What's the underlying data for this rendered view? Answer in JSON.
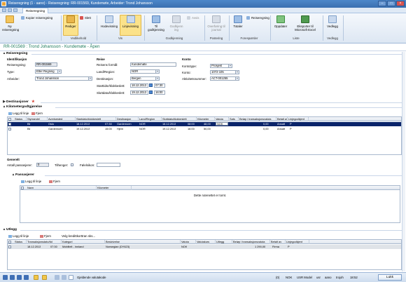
{
  "window": {
    "title": "Reiseregning (1 - aano) - Reiseregning: RR-001569, Kundemøte, Arbeider: Trond Johansson",
    "controls": {
      "minimize": "–",
      "maximize": "□",
      "close": "×"
    }
  },
  "ribbon_tab": "Reiseregning",
  "ribbon": {
    "new": {
      "label": "Ny reiseregning",
      "icon": "new-document-icon"
    },
    "copy": {
      "label": "Kopier reiseregning",
      "icon": "copy-icon"
    },
    "edit": {
      "label": "Rediger",
      "icon": "pencil-icon"
    },
    "delete": {
      "label": "Slett",
      "icon": "delete-icon"
    },
    "group_maintain": "Vedlikehold",
    "header_view": {
      "label": "Hodevisning",
      "icon": "header-view-icon"
    },
    "line_view": {
      "label": "Linjevisning",
      "icon": "line-view-icon"
    },
    "group_view": "Vis",
    "for_approval": {
      "label": "Til godkjenning",
      "icon": "submit-icon"
    },
    "approval": {
      "label": "Godkjenn ing",
      "icon": "approve-icon"
    },
    "reject": {
      "label": "Avvis",
      "icon": "reject-icon"
    },
    "group_approval": "Godkjenning",
    "post": {
      "label": "Overføring til journal",
      "icon": "post-icon"
    },
    "group_posting": "Postering",
    "totals": {
      "label": "Totaler",
      "icon": "totals-icon"
    },
    "accommodation": {
      "label": "Reiseregning",
      "icon": "travel-icon"
    },
    "group_enquiries": "Forespørsler",
    "refresh": {
      "label": "Oppdater",
      "icon": "refresh-icon"
    },
    "export": {
      "label": "Eksporter til Microsoft Excel",
      "icon": "excel-icon"
    },
    "group_list": "Liste",
    "attachments": {
      "label": "Vedlegg",
      "icon": "paperclip-icon"
    },
    "group_attachments": "Vedlegg"
  },
  "record_title": "RR-001569 : Trond Johansson - Kundemøte - Åpen",
  "sections": {
    "expense": "Reiseregning",
    "destinations": "Destinasjoner",
    "mileage": "Kilometergodtgjørelse",
    "general": "Generelt",
    "passengers": "Passasjerer",
    "expenses": "Utlegg"
  },
  "identification": {
    "heading": "Identifikasjon",
    "number_label": "Reiseregning:",
    "number": "RR-001569",
    "type_label": "Type:",
    "type": "Etter Regning",
    "worker_label": "Arbeider:",
    "worker": "Trond Johansson"
  },
  "trip": {
    "heading": "Reise",
    "purpose_label": "Reisens formål:",
    "purpose": "Kundemøte",
    "country_label": "Land/Region:",
    "country": "NOR",
    "destination_label": "Destinasjon:",
    "destination": "Bergen",
    "start_label": "Starttidsr/klokkeslett:",
    "start_date": "18.12.2013",
    "start_time": "07:30",
    "end_label": "Sluttdato/klokkeslett:",
    "end_date": "19.12.2013",
    "end_time": "16:00"
  },
  "account": {
    "heading": "Konto",
    "type_label": "Kontotype:",
    "type": "Prosjekt",
    "account_label": "Konto:",
    "account": "1072-105",
    "activity_label": "Aktivitetsnummer:",
    "activity": "ACT-001255"
  },
  "mileage_toolbar": {
    "add": "Legg til linje",
    "remove": "Fjern"
  },
  "mileage_columns": [
    "Status",
    "Styrrandel",
    "Avreisested",
    "Startdato/klokkeslett",
    "Destinasjon",
    "Land/Region",
    "Sluttdato/klokkeslett",
    "Kilometer",
    "Valuta",
    "Sats",
    "Beløp i transaksjonsvaluta",
    "Betalt av",
    "Linjegodkjent"
  ],
  "mileage_rows": [
    [
      "",
      "Bil",
      "Oslo",
      "18.12.2013",
      "07:30",
      "Gardemoen",
      "NOR",
      "18.12.2013",
      "08:00",
      "48,00",
      "NOK",
      "",
      "0,00",
      "Ansatt",
      "P"
    ],
    [
      "",
      "Bil",
      "Gardemoen",
      "19.12.2013",
      "15:00",
      "Hjem",
      "NOR",
      "19.12.2013",
      "16:00",
      "50,00",
      "",
      "",
      "0,00",
      "Ansatt",
      "P"
    ]
  ],
  "general": {
    "passengers_label": "Antall passasjerer:",
    "passengers": "0",
    "trailer_label": "Tilhenger:",
    "escort_label": "Følelsikon:"
  },
  "passengers_toolbar": {
    "add": "Legg til linje",
    "remove": "Fjern"
  },
  "passengers_columns": [
    "Navn",
    "Kilometer"
  ],
  "passengers_empty": "Dette rutenettet er tomt.",
  "expenses_toolbar": {
    "add": "Legg til linje",
    "remove": "Fjern",
    "card": "Velg kredittkorttran sks..."
  },
  "expenses_columns": [
    "Status",
    "Transaksjonsdato/tid",
    "Kategori",
    "Beskrivelse",
    "Valuta",
    "Valutakurs",
    "Utlegg",
    "Beløp i transaksjonsvaluta",
    "Betalt av",
    "Linjegodkjent"
  ],
  "expenses_rows": [
    [
      "",
      "18.12.2013",
      "07:30",
      "Mobiltelt - innland",
      "Norwegian (DY623)",
      "NOK",
      "",
      "",
      "1 290,00",
      "Firma",
      "P"
    ]
  ],
  "statusbar": {
    "hint": "Gjeldende valutakode",
    "items": [
      "(0)",
      "NOK",
      "USR Model",
      "usr",
      "aano",
      "trojoh",
      "18:52"
    ],
    "close": "Lukk"
  },
  "colors": {
    "accent": "#3a6fb0",
    "record_title": "#1e7b5c",
    "selected_row": "#0a246a",
    "highlight": "#fbe28a"
  }
}
